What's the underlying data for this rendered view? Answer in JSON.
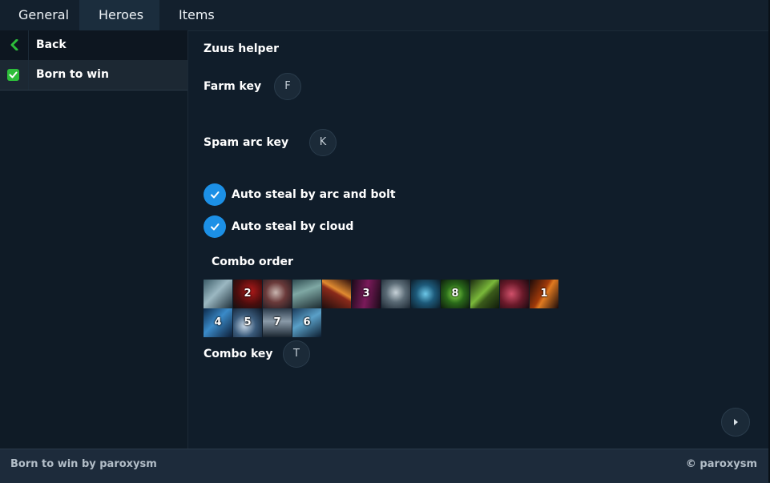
{
  "tabs": [
    {
      "label": "General"
    },
    {
      "label": "Heroes"
    },
    {
      "label": "Items"
    }
  ],
  "active_tab": "Heroes",
  "sidebar": {
    "back_label": "Back",
    "selected_label": "Born to win",
    "selected_checked": true
  },
  "content": {
    "heading": "Zuus helper",
    "farm_key": {
      "label": "Farm key",
      "value": "F"
    },
    "spam_arc_key": {
      "label": "Spam arc key",
      "value": "K"
    },
    "options": [
      {
        "label": "Auto steal by arc and bolt",
        "checked": true
      },
      {
        "label": "Auto steal by cloud",
        "checked": true
      }
    ],
    "combo_order": {
      "label": "Combo order",
      "abilities": [
        {
          "icon": "ice-spirit-ability-icon",
          "order": ""
        },
        {
          "icon": "red-demon-ability-icon",
          "order": "2"
        },
        {
          "icon": "armored-figure-ability-icon",
          "order": ""
        },
        {
          "icon": "teal-warrior-ability-icon",
          "order": ""
        },
        {
          "icon": "fire-spear-ability-icon",
          "order": ""
        },
        {
          "icon": "dark-dagger-ability-icon",
          "order": "3"
        },
        {
          "icon": "storm-face-ability-icon",
          "order": ""
        },
        {
          "icon": "blue-orb-ability-icon",
          "order": ""
        },
        {
          "icon": "green-sphere-ability-icon",
          "order": "8"
        },
        {
          "icon": "green-blade-ability-icon",
          "order": ""
        },
        {
          "icon": "red-claw-ability-icon",
          "order": ""
        },
        {
          "icon": "fire-blade-ability-icon",
          "order": "1"
        },
        {
          "icon": "ice-shard-ability-icon",
          "order": "4"
        },
        {
          "icon": "spirit-beast-ability-icon",
          "order": "5"
        },
        {
          "icon": "shadow-figure-ability-icon",
          "order": "7"
        },
        {
          "icon": "crystal-shield-ability-icon",
          "order": "6"
        }
      ]
    },
    "combo_key": {
      "label": "Combo key",
      "value": "T"
    }
  },
  "footer": {
    "left": "Born to win by paroxysm",
    "right": "©  paroxysm"
  },
  "colors": {
    "accent_blue": "#1c90e6",
    "check_green": "#2dbd3a",
    "background": "#101d2a",
    "footer": "#1d2b3b"
  }
}
